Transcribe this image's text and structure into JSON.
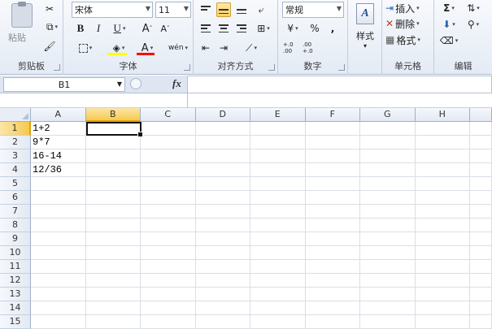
{
  "ribbon": {
    "clipboard": {
      "paste_label": "粘贴",
      "group_label": "剪贴板"
    },
    "font": {
      "font_name": "宋体",
      "font_size": "11",
      "bold": "B",
      "italic": "I",
      "underline": "U",
      "grow": "A",
      "shrink": "A",
      "font_color": "A",
      "phonetic": "wén",
      "group_label": "字体",
      "highlight_color": "#ffff00",
      "text_color": "#ff0000"
    },
    "alignment": {
      "group_label": "对齐方式"
    },
    "number": {
      "format": "常规",
      "currency": "¥",
      "percent": "%",
      "comma": ",",
      "inc_decimal": "+.0 .00",
      "dec_decimal": ".00 +.0",
      "group_label": "数字"
    },
    "styles": {
      "label": "样式"
    },
    "cells": {
      "insert": "插入",
      "delete": "删除",
      "format": "格式",
      "group_label": "单元格"
    },
    "editing": {
      "sum": "Σ",
      "group_label": "编辑"
    }
  },
  "formula_bar": {
    "name_box": "B1",
    "fx": "fx",
    "value": ""
  },
  "grid": {
    "columns": [
      "A",
      "B",
      "C",
      "D",
      "E",
      "F",
      "G",
      "H"
    ],
    "rows": [
      "1",
      "2",
      "3",
      "4",
      "5",
      "6",
      "7",
      "8",
      "9",
      "10",
      "11",
      "12",
      "13",
      "14",
      "15"
    ],
    "selected_column": "B",
    "selected_row": "1",
    "cells": {
      "A1": "1+2",
      "A2": "9*7",
      "A3": "16-14",
      "A4": "12/36"
    }
  }
}
